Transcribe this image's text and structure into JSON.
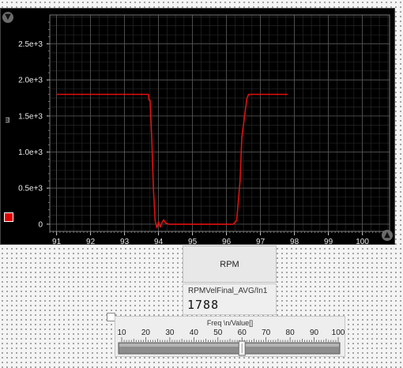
{
  "chart_data": {
    "type": "line",
    "xlim": [
      90.8,
      100.8
    ],
    "ylim": [
      -0.1,
      2.9
    ],
    "y_scale_label": "e+3",
    "y_axis_label": "m",
    "x_ticks": [
      "91",
      "92",
      "93",
      "94",
      "95",
      "96",
      "97",
      "98",
      "99",
      "100"
    ],
    "y_ticks": [
      {
        "value": 0,
        "label": "0"
      },
      {
        "value": 0.5,
        "label": "0.5e+3"
      },
      {
        "value": 1.0,
        "label": "1.0e+3"
      },
      {
        "value": 1.5,
        "label": "1.5e+3"
      },
      {
        "value": 2.0,
        "label": "2.0e+3"
      },
      {
        "value": 2.5,
        "label": "2.5e+3"
      }
    ],
    "grid": true,
    "series": [
      {
        "color": "#e01010",
        "x": [
          91.0,
          93.7,
          93.72,
          93.75,
          93.8,
          93.85,
          93.9,
          93.95,
          94.0,
          94.05,
          94.1,
          94.15,
          94.2,
          94.3,
          94.5,
          95.0,
          96.0,
          96.2,
          96.3,
          96.4,
          96.45,
          96.6,
          96.65,
          96.8,
          97.0,
          97.5,
          97.8
        ],
        "y": [
          1.8,
          1.8,
          1.72,
          1.72,
          1.2,
          0.5,
          0.05,
          -0.05,
          0.03,
          -0.04,
          0.02,
          0.06,
          0.02,
          0.0,
          0.0,
          0.0,
          0.0,
          0.0,
          0.05,
          0.6,
          1.2,
          1.74,
          1.8,
          1.8,
          1.8,
          1.8,
          1.8
        ]
      }
    ],
    "series_swatch_color": "#e00000"
  },
  "indicator": {
    "button_label": "RPM",
    "channel_name": "RPMVelFinal_AVG/In1",
    "value": "1788"
  },
  "slider": {
    "title": "Freq \\n/Value[]",
    "ticks": [
      "10",
      "20",
      "30",
      "40",
      "50",
      "60",
      "70",
      "80",
      "90",
      "100"
    ],
    "min": 10,
    "max": 100,
    "value": 60
  }
}
